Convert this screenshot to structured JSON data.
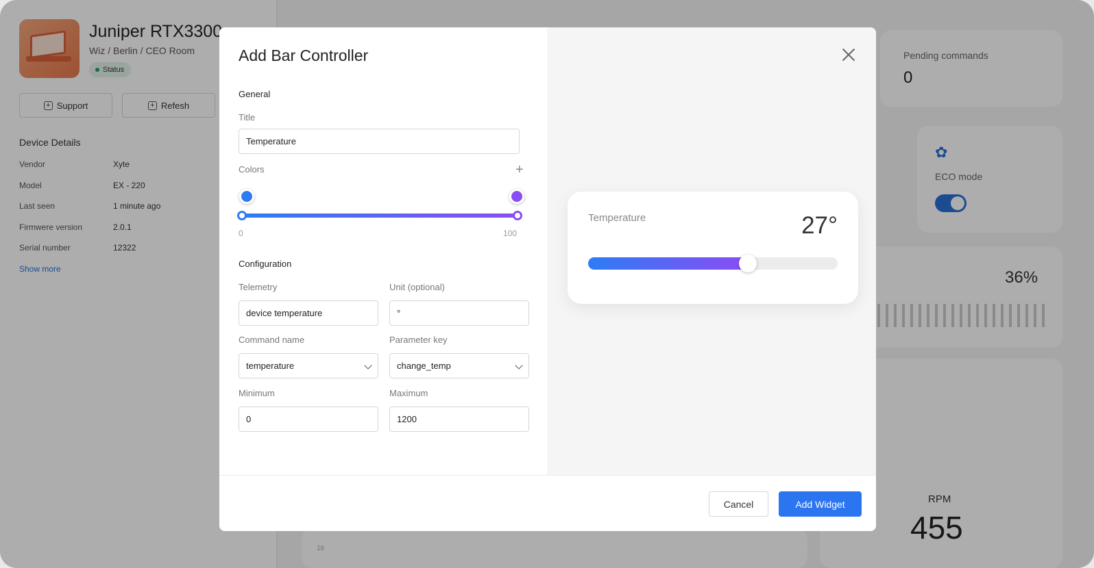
{
  "device": {
    "name": "Juniper RTX3300",
    "path": "Wiz / Berlin / CEO Room",
    "status": "Status",
    "support_label": "Support",
    "refresh_label": "Refesh",
    "details_heading": "Device Details",
    "details": [
      {
        "label": "Vendor",
        "value": "Xyte"
      },
      {
        "label": "Model",
        "value": "EX - 220"
      },
      {
        "label": "Last seen",
        "value": "1 minute ago"
      },
      {
        "label": "Firmwere version",
        "value": "2.0.1"
      },
      {
        "label": "Serial number",
        "value": "12322"
      }
    ],
    "show_more": "Show more"
  },
  "dashboard": {
    "pending_label": "Pending commands",
    "pending_value": "0",
    "eco_label": "ECO mode",
    "eco_on": true,
    "percent": "36%",
    "rpm_label": "RPM",
    "rpm_value": "455",
    "chart_tick": "16"
  },
  "modal": {
    "title": "Add Bar Controller",
    "general_heading": "General",
    "title_label": "Title",
    "title_value": "Temperature",
    "colors_label": "Colors",
    "color_start": "#2d7cf6",
    "color_end": "#8a4cf3",
    "range_min": "0",
    "range_max": "100",
    "config_heading": "Configuration",
    "telemetry_label": "Telemetry",
    "telemetry_value": "device temperature",
    "unit_label": "Unit (optional)",
    "unit_value": "°",
    "command_label": "Command name",
    "command_value": "temperature",
    "param_label": "Parameter key",
    "param_value": "change_temp",
    "min_label": "Minimum",
    "min_value": "0",
    "max_label": "Maximum",
    "max_value": "1200",
    "cancel_label": "Cancel",
    "add_label": "Add Widget"
  },
  "preview": {
    "title": "Temperature",
    "value": "27°",
    "fill_percent": 64
  }
}
